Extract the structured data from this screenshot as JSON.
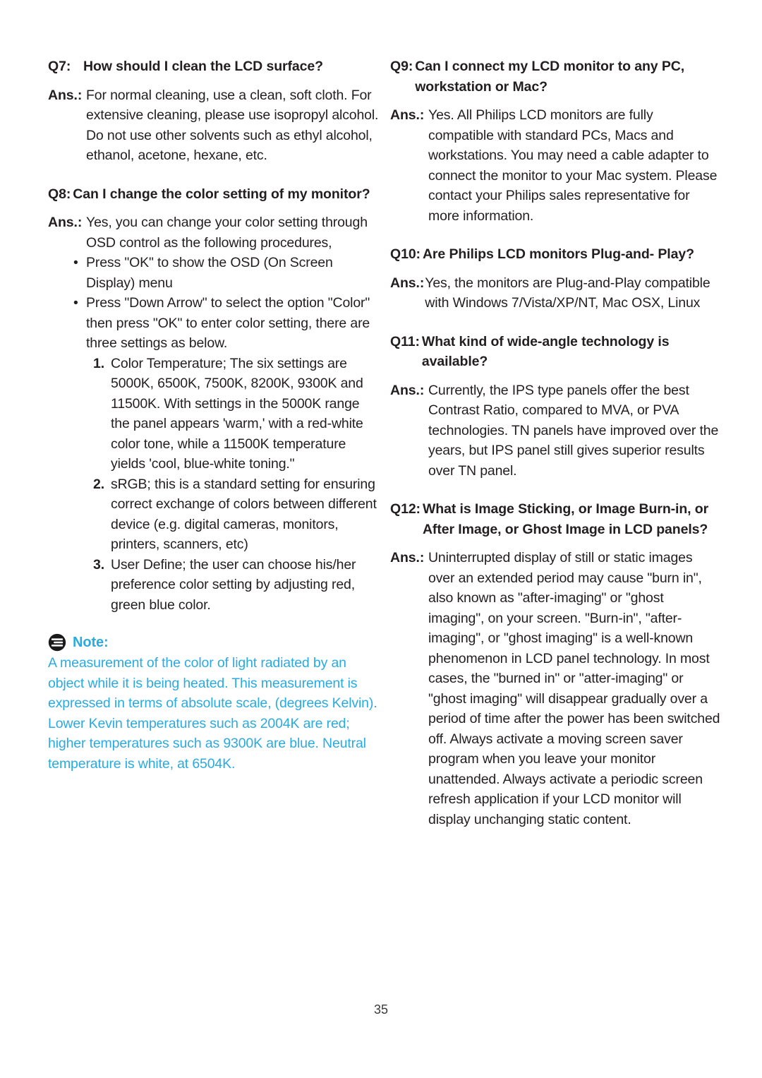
{
  "document": {
    "page_number": "35",
    "note_color": "#29ABE2",
    "text_color": "#231f20"
  },
  "left_column": {
    "q7": {
      "label": "Q7:",
      "question": "How should I clean the LCD surface?",
      "ans_label": "Ans.:",
      "answer": "For normal cleaning, use a clean, soft cloth. For extensive cleaning, please use isopropyl alcohol. Do not use other solvents such as ethyl alcohol, ethanol, acetone, hexane, etc."
    },
    "q8": {
      "label": "Q8:",
      "question": "Can I change the color setting of my monitor?",
      "ans_label": "Ans.:",
      "answer": "Yes, you can change your color setting through OSD control as the following procedures,",
      "bullets": [
        "Press \"OK\" to show the OSD (On Screen Display) menu",
        "Press \"Down Arrow\" to select the option \"Color\" then press \"OK\" to enter color setting, there are three settings as below."
      ],
      "numbered": [
        {
          "num": "1.",
          "text": "Color Temperature; The six settings are 5000K, 6500K, 7500K, 8200K, 9300K and 11500K. With settings in the 5000K range the panel appears 'warm,' with a red-white color tone, while a 11500K temperature yields 'cool, blue-white toning.\""
        },
        {
          "num": "2.",
          "text": "sRGB; this is a standard setting for ensuring correct exchange of colors between different device (e.g. digital cameras, monitors, printers, scanners, etc)"
        },
        {
          "num": "3.",
          "text": "User Define; the user can choose his/her preference color setting by adjusting red, green blue color."
        }
      ]
    },
    "note": {
      "icon": "note-icon",
      "title": "Note:",
      "body": "A measurement of the color of light radiated by an object while it is being heated. This measurement is expressed in terms of absolute scale, (degrees Kelvin). Lower Kevin temperatures such as 2004K are red; higher temperatures such as 9300K are blue. Neutral temperature is white, at 6504K."
    }
  },
  "right_column": {
    "q9": {
      "label": "Q9:",
      "question": "Can I connect my LCD monitor to any PC, workstation or Mac?",
      "ans_label": "Ans.:",
      "answer": "Yes. All Philips LCD monitors are fully compatible with standard PCs, Macs and workstations. You may need a cable adapter to connect the monitor to your Mac system. Please contact your Philips sales representative for more information."
    },
    "q10": {
      "label": "Q10:",
      "question": "Are Philips LCD monitors Plug-and- Play?",
      "ans_label": "Ans.:",
      "answer": "Yes, the monitors are Plug-and-Play compatible with Windows 7/Vista/XP/NT, Mac OSX, Linux"
    },
    "q11": {
      "label": "Q11:",
      "question": "What kind of wide-angle technology is available?",
      "ans_label": "Ans.:",
      "answer": "Currently, the IPS type panels offer the best Contrast Ratio, compared to MVA, or PVA technologies. TN panels have improved over the years, but IPS panel still gives superior results over TN panel."
    },
    "q12": {
      "label": "Q12:",
      "question": "What is Image Sticking, or Image Burn-in, or After Image, or Ghost Image in LCD panels?",
      "ans_label": "Ans.:",
      "answer": "Uninterrupted display of still or static images over an extended period may cause \"burn in\", also known as \"after-imaging\" or \"ghost imaging\", on your screen. \"Burn-in\", \"after-imaging\", or \"ghost imaging\" is a well-known phenomenon in LCD panel technology. In most cases, the \"burned in\" or \"atter-imaging\" or \"ghost imaging\" will disappear gradually over a period of time after the power has been switched off. Always activate a moving screen saver program when you leave your monitor unattended. Always activate a periodic screen refresh application if your LCD monitor will display unchanging static content."
    }
  }
}
